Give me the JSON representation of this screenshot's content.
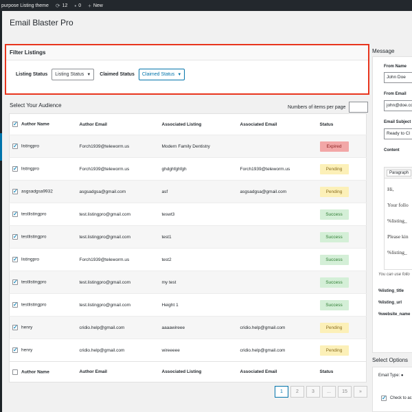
{
  "adminbar": {
    "site": "purpose Listing theme",
    "updates": "12",
    "comments": "0",
    "new": "New"
  },
  "page": {
    "title": "Email Blaster Pro"
  },
  "filter": {
    "heading": "Filter Listings",
    "listing_status_label": "Listing Status",
    "listing_status_value": "Listing Status",
    "claimed_status_label": "Claimed Status",
    "claimed_status_value": "Claimed Status"
  },
  "audience": {
    "title": "Select Your Audience",
    "per_page_label": "Numbers of items per page",
    "columns": [
      "Author Name",
      "Author Email",
      "Associated Listing",
      "Associated Email",
      "Status"
    ],
    "rows": [
      {
        "author": "listingpro",
        "email": "Forch1939@teleworm.us",
        "listing": "Modern Family Dentistry",
        "assoc_email": "",
        "status": "Expired",
        "kind": "expired"
      },
      {
        "author": "listingpro",
        "email": "Forch1939@teleworm.us",
        "listing": "ghdghfghfgh",
        "assoc_email": "Forch1939@teleworm.us",
        "status": "Pending",
        "kind": "pending"
      },
      {
        "author": "asgsadgsa9932",
        "email": "asgsadgsa@gmail.com",
        "listing": "asf",
        "assoc_email": "asgsadgsa@gmail.com",
        "status": "Pending",
        "kind": "pending"
      },
      {
        "author": "testlistingpro",
        "email": "test.listingpro@gmail.com",
        "listing": "teswt3",
        "assoc_email": "",
        "status": "Success",
        "kind": "success"
      },
      {
        "author": "testlistingpro",
        "email": "test.listingpro@gmail.com",
        "listing": "test1",
        "assoc_email": "",
        "status": "Success",
        "kind": "success"
      },
      {
        "author": "listingpro",
        "email": "Forch1939@teleworm.us",
        "listing": "test2",
        "assoc_email": "",
        "status": "Success",
        "kind": "success"
      },
      {
        "author": "testlistingpro",
        "email": "test.listingpro@gmail.com",
        "listing": "my test",
        "assoc_email": "",
        "status": "Success",
        "kind": "success"
      },
      {
        "author": "testlistingpro",
        "email": "test.listingpro@gmail.com",
        "listing": "Height 1",
        "assoc_email": "",
        "status": "Success",
        "kind": "success"
      },
      {
        "author": "henry",
        "email": "cridio.help@gmail.com",
        "listing": "aaaawireee",
        "assoc_email": "cridio.help@gmail.com",
        "status": "Pending",
        "kind": "pending"
      },
      {
        "author": "henry",
        "email": "cridio.help@gmail.com",
        "listing": "wireeeee",
        "assoc_email": "cridio.help@gmail.com",
        "status": "Pending",
        "kind": "pending"
      }
    ]
  },
  "pagination": [
    "1",
    "2",
    "3",
    "...",
    "15",
    "»"
  ],
  "message": {
    "title": "Message",
    "from_name_label": "From Name",
    "from_name_value": "John Doe",
    "from_email_label": "From Email",
    "from_email_value": "john@doe.com",
    "subject_label": "Email Subject",
    "subject_value": "Ready to Cl",
    "content_label": "Content",
    "editor_format": "Paragraph",
    "editor_lines": [
      "Hi,",
      "Your follo",
      "%listing_",
      "Please kin",
      "%listing_"
    ],
    "note": "You can use follo",
    "vars": [
      "%listing_title",
      "%listing_url",
      "%website_name"
    ]
  },
  "options": {
    "title": "Select Options",
    "email_type_label": "Email Type:",
    "check_label": "Check to ac"
  }
}
